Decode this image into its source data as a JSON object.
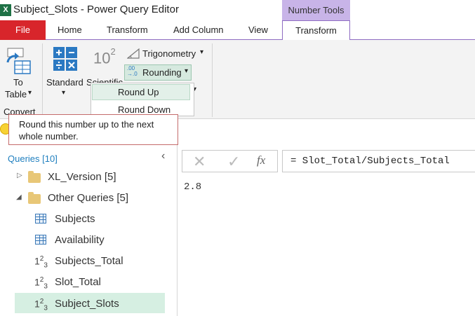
{
  "title_bar": {
    "title": "Subject_Slots - Power Query Editor",
    "context_group": "Number Tools"
  },
  "tabs": {
    "file": "File",
    "home": "Home",
    "transform": "Transform",
    "add_column": "Add Column",
    "view": "View",
    "ctx_transform": "Transform"
  },
  "ribbon": {
    "to_table_line1": "To",
    "to_table_line2": "Table",
    "convert_group": "Convert",
    "standard": "Standard",
    "scientific": "Scientific",
    "trigonometry": "Trigonometry",
    "rounding": "Rounding",
    "rounding_icon_top": ".00",
    "rounding_icon_bottom": "→.0",
    "sci_icon": "10",
    "sci_exp": "2"
  },
  "rounding_menu": {
    "round_up": "Round Up",
    "round_down": "Round Down"
  },
  "tooltip": {
    "text": "Round this number up to the next whole number."
  },
  "queries": {
    "header": "Queries [10]",
    "items": [
      {
        "label": "XL_Version [5]",
        "icon": "folder-icon"
      },
      {
        "label": "Other Queries [5]",
        "icon": "folder-icon"
      },
      {
        "label": "Subjects",
        "icon": "table-icon"
      },
      {
        "label": "Availability",
        "icon": "table-icon"
      },
      {
        "label": "Subjects_Total",
        "icon": "number-icon"
      },
      {
        "label": "Slot_Total",
        "icon": "number-icon"
      },
      {
        "label": "Subject_Slots",
        "icon": "number-icon"
      }
    ],
    "number_icon_text": "123"
  },
  "formula_bar": {
    "formula": "= Slot_Total/Subjects_Total",
    "fx": "fx"
  },
  "result": {
    "value": "2.8"
  },
  "colors": {
    "accent_purple": "#8e6cc2",
    "file_red": "#d8252b",
    "selected_green": "#d6efe2",
    "query_blue": "#1f7fbf"
  }
}
